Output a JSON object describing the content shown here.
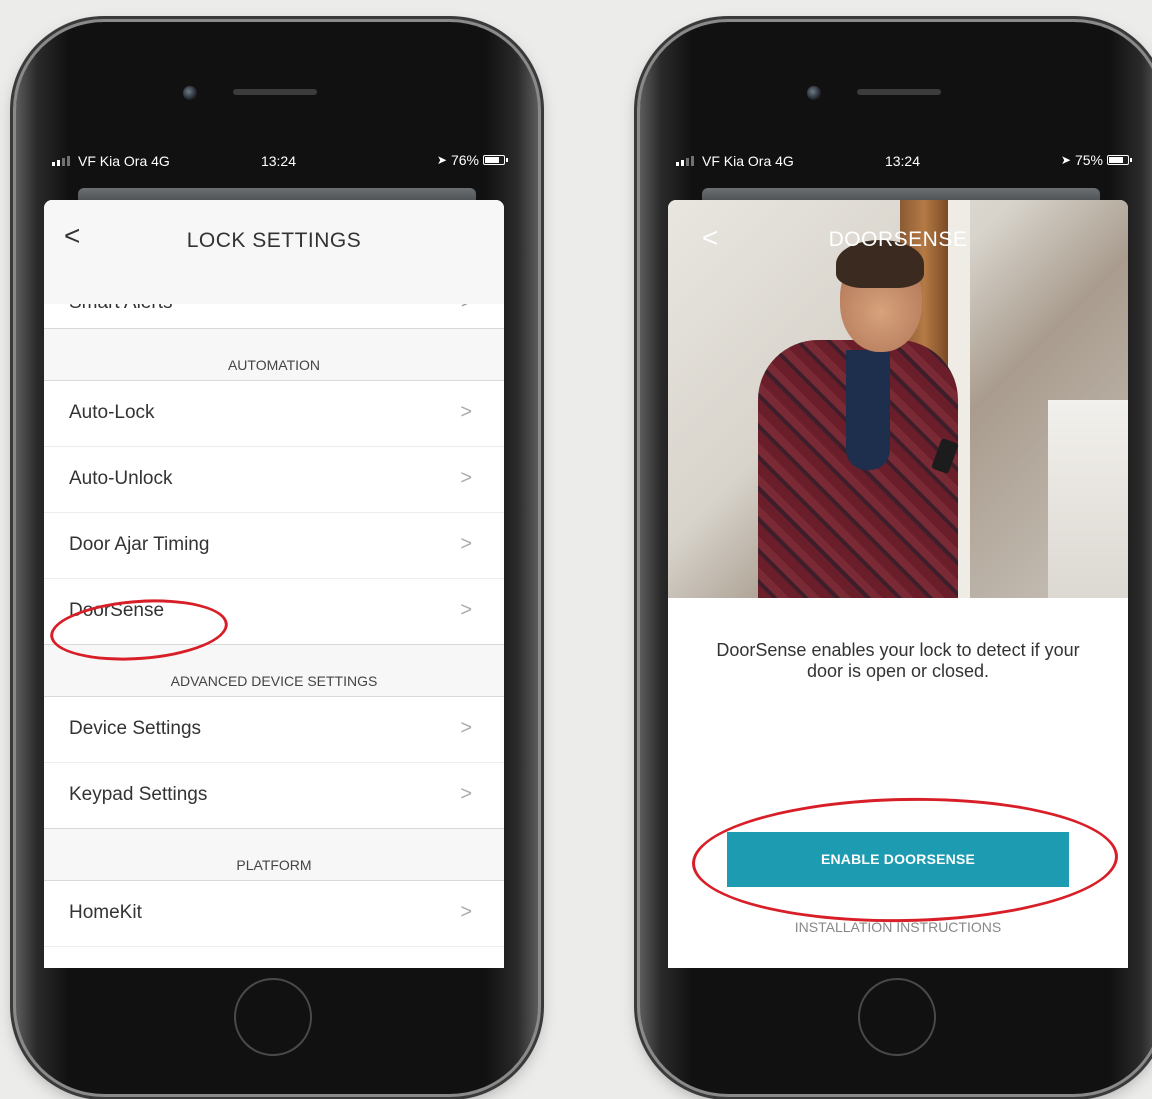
{
  "left_phone": {
    "status": {
      "carrier": "VF Kia Ora  4G",
      "time": "13:24",
      "battery": "76%",
      "battery_level": 0.76
    },
    "screen": {
      "title": "LOCK SETTINGS",
      "back_glyph": "<",
      "cut_row": {
        "label": "Smart Alerts",
        "chevron": ">"
      },
      "sections": [
        {
          "header": "AUTOMATION",
          "rows": [
            "Auto-Lock",
            "Auto-Unlock",
            "Door Ajar Timing",
            "DoorSense"
          ]
        },
        {
          "header": "ADVANCED DEVICE SETTINGS",
          "rows": [
            "Device Settings",
            "Keypad Settings"
          ]
        },
        {
          "header": "PLATFORM",
          "rows": [
            "HomeKit"
          ]
        }
      ],
      "chevron": ">"
    }
  },
  "right_phone": {
    "status": {
      "carrier": "VF Kia Ora  4G",
      "time": "13:24",
      "battery": "75%",
      "battery_level": 0.75
    },
    "screen": {
      "title": "DOORSENSE",
      "back_glyph": "<",
      "description": "DoorSense enables your lock to detect if your door is open or closed.",
      "enable_button": "ENABLE DOORSENSE",
      "install_link": "INSTALLATION INSTRUCTIONS"
    }
  },
  "colors": {
    "accent_button": "#1d9bb1",
    "annotation_red": "#d81e27"
  },
  "icons": {
    "back": "chevron-left-icon",
    "row": "chevron-right-icon",
    "location": "location-arrow-icon"
  }
}
